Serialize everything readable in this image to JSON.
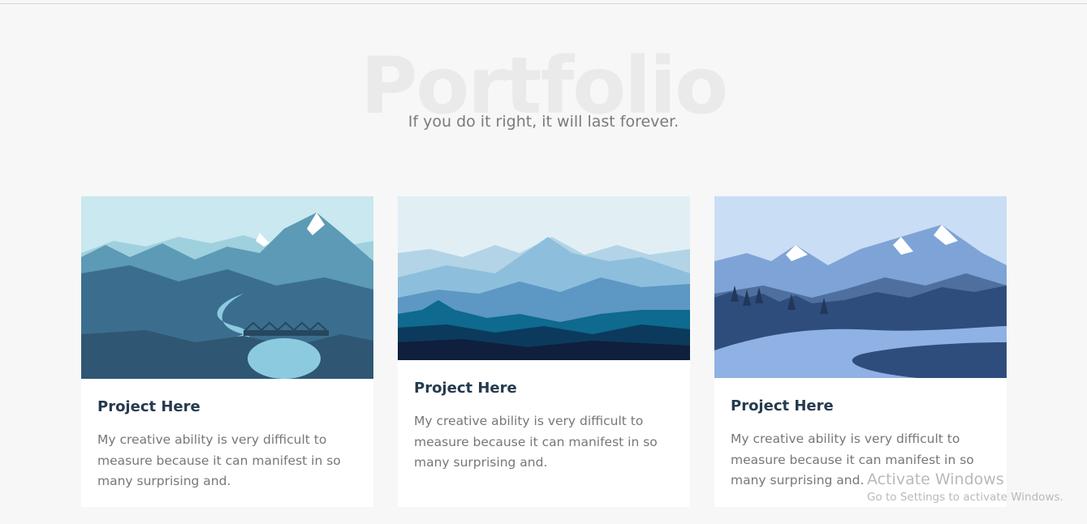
{
  "section": {
    "title": "Portfolio",
    "subtitle": "If you do it right, it will last forever."
  },
  "cards": [
    {
      "title": "Project Here",
      "description": "My creative ability is very difficult to measure because it can manifest in so many surprising and.",
      "image_icon": "mountain-bridge-illustration"
    },
    {
      "title": "Project Here",
      "description": "My creative ability is very difficult to measure because it can manifest in so many surprising and.",
      "image_icon": "mountain-range-illustration"
    },
    {
      "title": "Project Here",
      "description": "My creative ability is very difficult to measure because it can manifest in so many surprising and.",
      "image_icon": "snowy-mountains-river-illustration"
    }
  ],
  "watermark": {
    "title": "Activate Windows",
    "subtitle": "Go to Settings to activate Windows."
  },
  "colors": {
    "background": "#f7f7f7",
    "card": "#ffffff",
    "heading": "#253a4f",
    "body_text": "#777777"
  }
}
